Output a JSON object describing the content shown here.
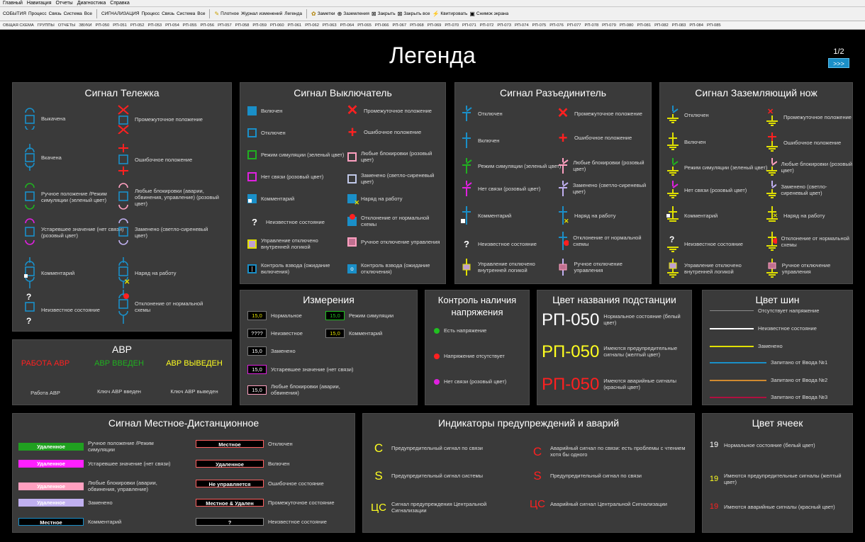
{
  "menubar": [
    "Главный",
    "Навигация",
    "Отчеты",
    "Диагностика",
    "Справка"
  ],
  "toolbar": {
    "sobytiya": "СОБЫТИЯ",
    "g1": [
      "Процесс",
      "Связь",
      "Система",
      "Все"
    ],
    "signal": "СИГНАЛИЗАЦИЯ",
    "g2": [
      "Процесс",
      "Связь",
      "Система",
      "Все"
    ],
    "b1": "Плотное",
    "b2": "Журнал изменений",
    "b3": "Легенда",
    "b4": "Заметки",
    "b5": "Заземления",
    "b6": "Закрыть",
    "b7": "Закрыть все",
    "b8": "Квитировать",
    "b9": "Снимок экрана"
  },
  "schemebar": [
    "ОБЩАЯ СХЕМА",
    "ГРУППЫ",
    "ОТЧЕТЫ",
    "ЗВУКИ",
    "РП-050",
    "РП-051",
    "РП-052",
    "РП-053",
    "РП-054",
    "РП-055",
    "РП-056",
    "РП-057",
    "РП-058",
    "РП-059",
    "РП-060",
    "РП-061",
    "РП-062",
    "РП-063",
    "РП-064",
    "РП-065",
    "РП-066",
    "РП-067",
    "РП-068",
    "РП-069",
    "РП-070",
    "РП-071",
    "РП-072",
    "РП-073",
    "РП-074",
    "РП-075",
    "РП-076",
    "РП-077",
    "РП-078",
    "РП-079",
    "РП-080",
    "РП-081",
    "РП-082",
    "РП-083",
    "РП-084",
    "РП-085"
  ],
  "page": {
    "title": "Легенда",
    "pager": "1/2",
    "next": ">>>"
  },
  "telezhka": {
    "title": "Сигнал Тележка",
    "items": [
      "Выкачена",
      "Вкачена",
      "Ручное положение /Режим симуляции (зеленый цвет)",
      "Устаревшее значение (нет связи) (розовый цвет)",
      "Комментарий",
      "Неизвестное состояние",
      "Промежуточное положение",
      "Ошибочное положение",
      "Любые блокировки (аварии, обвинения, управление) (розовый цвет)",
      "Заменено (светло-сиреневый цвет)",
      "Наряд на работу",
      "Отклонение от нормальной схемы"
    ]
  },
  "vykl": {
    "title": "Сигнал Выключатель",
    "items": [
      "Включен",
      "Отключен",
      "Режим симуляции (зеленый цвет)",
      "Нет связи (розовый цвет)",
      "Комментарий",
      "Неизвестное состояние",
      "Управление отключено внутренней логикой",
      "Контроль взвода (ожидание включения)",
      "Промежуточное положение",
      "Ошибочное положение",
      "Любые блокировки (розовый цвет)",
      "Заменено (светло-сиреневый цвет)",
      "Наряд на работу",
      "Отклонение от нормальной схемы",
      "Ручное отключение управления",
      "Контроль взвода (ожидание отключения)"
    ]
  },
  "razed": {
    "title": "Сигнал Разъединитель",
    "items": [
      "Отключен",
      "Включен",
      "Режим симуляции (зеленый цвет)",
      "Нет связи (розовый цвет)",
      "Комментарий",
      "Неизвестное состояние",
      "Управление отключено внутренней логикой",
      "Промежуточное положение",
      "Ошибочное положение",
      "Любые блокировки (розовый цвет)",
      "Заменено (светло-сиреневый цвет)",
      "Наряд на работу",
      "Отклонение от нормальной схемы",
      "Ручное отключение управления"
    ]
  },
  "zazem": {
    "title": "Сигнал Заземляющий нож",
    "items": [
      "Отключен",
      "Включен",
      "Режим симуляции (зеленый цвет)",
      "Нет связи (розовый цвет)",
      "Комментарий",
      "Неизвестное состояние",
      "Управление отключено внутренней логикой",
      "Промежуточное положение",
      "Ошибочное положение",
      "Любые блокировки (розовый цвет)",
      "Заменено (светло-сиреневый цвет)",
      "Наряд на работу",
      "Отклонение от нормальной схемы",
      "Ручное отключение управления"
    ]
  },
  "izm": {
    "title": "Измерения",
    "v": [
      "15,0",
      "????",
      "15,0",
      "15,0",
      "15,0"
    ],
    "labels": [
      "Нормальное",
      "Неизвестное",
      "Заменено",
      "Устаревшее значение (нет связи)",
      "Любые блокировки (аварии, обвинения)"
    ],
    "v2": [
      "15,0",
      "15,0"
    ],
    "labels2": [
      "Режим симуляции",
      "Комментарий"
    ]
  },
  "kontrol": {
    "title": "Контроль наличия напряжения",
    "items": [
      "Есть напряжение",
      "Напряжение отсутствует",
      "Нет связи (розовый цвет)"
    ]
  },
  "podst": {
    "title": "Цвет названия подстанции",
    "name": "РП-050",
    "labels": [
      "Нормальное состояние (белый цвет)",
      "Имеются предупредительные сигналы (желтый цвет)",
      "Имеются аварийные сигналы (красный цвет)"
    ]
  },
  "shiny": {
    "title": "Цвет шин",
    "items": [
      "Отсутствует напряжение",
      "Неизвестное состояние",
      "Заменено",
      "Запитано от Ввода №1",
      "Запитано от Ввода №2",
      "Запитано от Ввода №3"
    ],
    "colors": [
      "#8a8a8a",
      "#ffffff",
      "#e0e000",
      "#1a8fc8",
      "#d08a30",
      "#b01040"
    ]
  },
  "avr": {
    "title": "АВР",
    "states": [
      "РАБОТА АВР",
      "АВР ВВЕДЕН",
      "АВР ВЫВЕДЕН"
    ],
    "labels": [
      "Работа АВР",
      "Ключ АВР введен",
      "Ключ АВР выведен"
    ]
  },
  "mestnoe": {
    "title": "Сигнал Местное-Дистанционное",
    "left_badges": [
      "Удаленное",
      "Удаленное",
      "Удаленное",
      "Удаленное",
      "Местное"
    ],
    "left_labels": [
      "Ручное положение /Режим симуляции",
      "Устаревшее значение (нет связи)",
      "Любые блокировки (аварии, обвинения, управление)",
      "Заменено",
      "Комментарий"
    ],
    "right_badges": [
      "Местное",
      "Удаленное",
      "Не управляется",
      "Местное & Удален",
      "?"
    ],
    "right_labels": [
      "Отключен",
      "Включен",
      "Ошибочное состояние",
      "Промежуточное состояние",
      "Неизвестное состояние"
    ]
  },
  "indik": {
    "title": "Индикаторы предупреждений и аварий",
    "left_sym": [
      "С",
      "S",
      "ЦС"
    ],
    "left_labels": [
      "Предупредительный сигнал по связи",
      "Предупредительный сигнал системы",
      "Сигнал предупреждения Центральной Сигнализации"
    ],
    "right_sym": [
      "С",
      "S",
      "ЦС"
    ],
    "right_labels": [
      "Аварийный сигнал по связи: есть проблемы с чтением хотя бы одного",
      "Предупредительный сигнал по связи",
      "Аварийный сигнал Центральной Сигнализации"
    ]
  },
  "yacheek": {
    "title": "Цвет ячеек",
    "nums": [
      "19",
      "19",
      "19"
    ],
    "labels": [
      "Нормальное состояние (белый цвет)",
      "Имеются предупредительные сигналы (желтый цвет)",
      "Имеются аварийные сигналы (красный цвет)"
    ]
  }
}
